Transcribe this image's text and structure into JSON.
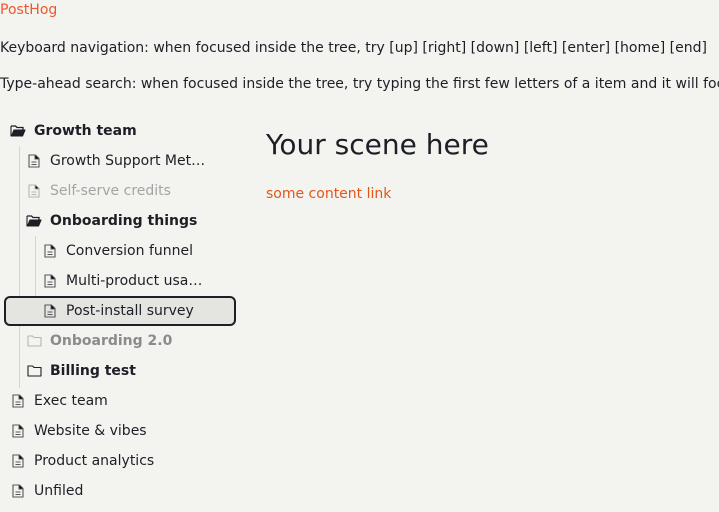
{
  "brand": {
    "link_label": "PostHog"
  },
  "help": {
    "keyboard": "Keyboard navigation: when focused inside the tree, try [up] [right] [down] [left] [enter] [home] [end]",
    "typeahead": "Type-ahead search: when focused inside the tree, try typing the first few letters of a item and it will focus it"
  },
  "tree": {
    "growth_team": "Growth team",
    "growth_support": "Growth Support Met…",
    "self_serve": "Self-serve credits",
    "onboarding_things": "Onboarding things",
    "conversion_funnel": "Conversion funnel",
    "multi_product": "Multi-product usa…",
    "post_install": "Post-install survey",
    "onboarding_2": "Onboarding 2.0",
    "billing_test": "Billing test",
    "exec_team": "Exec team",
    "website_vibes": "Website & vibes",
    "product_analytics": "Product analytics",
    "unfiled": "Unfiled"
  },
  "scene": {
    "title": "Your scene here",
    "link": "some content link"
  },
  "colors": {
    "accent": "#f0572c",
    "background": "#f3f3ef",
    "selected_bg": "#e4e4e1"
  },
  "icons": [
    "folder-open-icon",
    "folder-icon",
    "document-icon"
  ]
}
